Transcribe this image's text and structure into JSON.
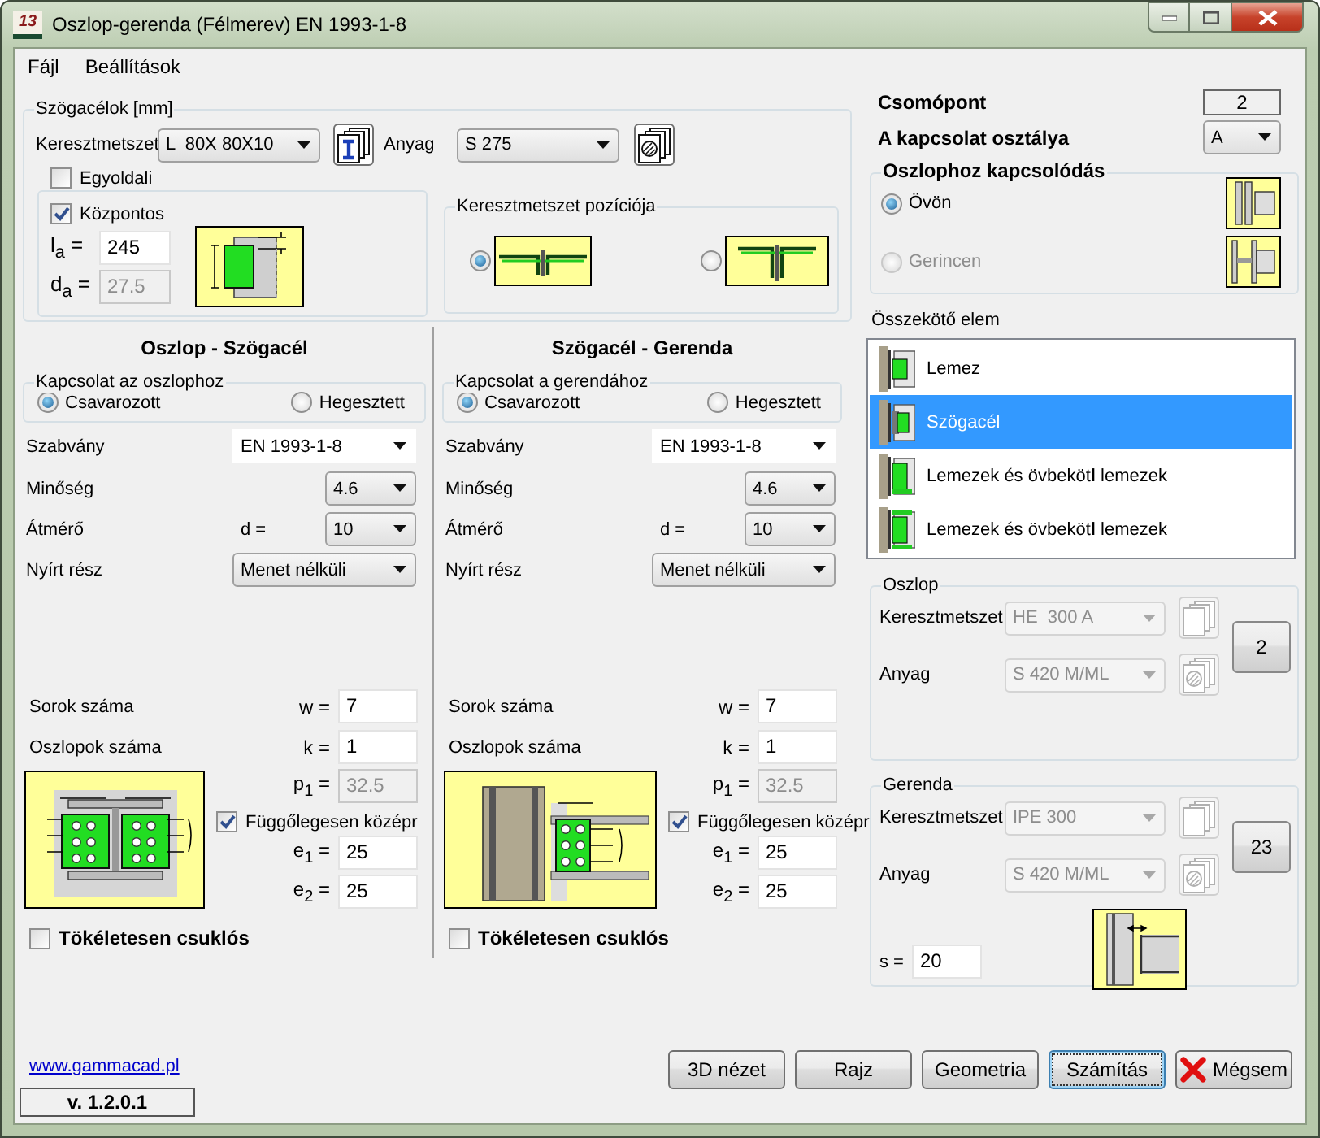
{
  "window": {
    "title": "Oszlop-gerenda (Félmerev) EN 1993-1-8",
    "app_badge": "13"
  },
  "menu": [
    "Fájl",
    "Beállítások"
  ],
  "angles": {
    "title": "Szögacélok [mm]",
    "section": {
      "label": "Keresztmetszet",
      "value": "L  80X 80X10"
    },
    "material": {
      "label": "Anyag",
      "value": "S 275"
    },
    "one_sided": {
      "label": "Egyoldali",
      "checked": false
    },
    "centric": {
      "label": "Központos",
      "checked": true
    },
    "la": {
      "label": "l$_{a}$ =",
      "value": "245",
      "disabled": false
    },
    "da": {
      "label": "d$_{a}$ =",
      "value": "27.5",
      "disabled": true
    },
    "position": {
      "title": "Keresztmetszet pozíciója",
      "options": [
        {
          "kind": "flush",
          "selected": true
        },
        {
          "kind": "raised",
          "selected": false
        }
      ]
    }
  },
  "connections": [
    {
      "kind": "column",
      "title": "Oszlop - Szögacél",
      "group": "Kapcsolat az oszlophoz",
      "options": [
        {
          "label": "Csavarozott",
          "selected": true
        },
        {
          "label": "Hegesztett",
          "selected": false
        }
      ],
      "standard": {
        "label": "Szabvány",
        "value": "EN 1993-1-8"
      },
      "grade": {
        "label": "Minőség",
        "value": "4.6"
      },
      "diameter": {
        "label": "Átmérő",
        "symbol": "d =",
        "value": "10"
      },
      "shear": {
        "label": "Nyírt rész",
        "value": "Menet nélküli"
      },
      "rows": {
        "label": "Sorok száma",
        "symbol": "w =",
        "value": "7"
      },
      "cols": {
        "label": "Oszlopok száma",
        "symbol": "k =",
        "value": "1"
      },
      "p1": {
        "symbol": "p$_{1}$ =",
        "value": "32.5",
        "disabled": true
      },
      "centered": {
        "label": "Függőlegesen középr",
        "checked": true
      },
      "e1": {
        "symbol": "e$_{1}$ =",
        "value": "25",
        "disabled": false
      },
      "e2": {
        "symbol": "e$_{2}$ =",
        "value": "25",
        "disabled": false
      },
      "pinned": {
        "label": "Tökéletesen csuklós",
        "checked": false
      }
    },
    {
      "kind": "beam",
      "title": "Szögacél - Gerenda",
      "group": "Kapcsolat a gerendához",
      "options": [
        {
          "label": "Csavarozott",
          "selected": true
        },
        {
          "label": "Hegesztett",
          "selected": false
        }
      ],
      "standard": {
        "label": "Szabvány",
        "value": "EN 1993-1-8"
      },
      "grade": {
        "label": "Minőség",
        "value": "4.6"
      },
      "diameter": {
        "label": "Átmérő",
        "symbol": "d =",
        "value": "10"
      },
      "shear": {
        "label": "Nyírt rész",
        "value": "Menet nélküli"
      },
      "rows": {
        "label": "Sorok száma",
        "symbol": "w =",
        "value": "7"
      },
      "cols": {
        "label": "Oszlopok száma",
        "symbol": "k =",
        "value": "1"
      },
      "p1": {
        "symbol": "p$_{1}$ =",
        "value": "32.5",
        "disabled": true
      },
      "centered": {
        "label": "Függőlegesen középr",
        "checked": true
      },
      "e1": {
        "symbol": "e$_{1}$ =",
        "value": "25",
        "disabled": false
      },
      "e2": {
        "symbol": "e$_{2}$ =",
        "value": "25",
        "disabled": false
      },
      "pinned": {
        "label": "Tökéletesen csuklós",
        "checked": false
      }
    }
  ],
  "joint": {
    "node": {
      "label": "Csomópont",
      "value": "2"
    },
    "class": {
      "label": "A kapcsolat osztálya",
      "value": "A"
    },
    "attach": {
      "title": "Oszlophoz kapcsolódás",
      "options": [
        {
          "kind": "flange",
          "label": "Övön",
          "selected": true,
          "disabled": false
        },
        {
          "kind": "web",
          "label": "Gerincen",
          "selected": false,
          "disabled": true
        }
      ]
    },
    "connector": {
      "title": "Összekötő elem",
      "items": [
        {
          "kind": "plate",
          "label": "Lemez",
          "selected": false
        },
        {
          "kind": "angle",
          "label": "Szögacél",
          "selected": true
        },
        {
          "kind": "end_plate",
          "label": "Lemezek és övbeköt**l** lemezek",
          "selected": false
        },
        {
          "kind": "end_plate_haunch",
          "label": "Lemezek és övbeköt**l** lemezek",
          "selected": false
        }
      ]
    },
    "members": [
      {
        "title": "Oszlop",
        "section": {
          "label": "Keresztmetszet",
          "value": "HE  300 A",
          "disabled": true
        },
        "material": {
          "label": "Anyag",
          "value": "S 420 M/ML",
          "disabled": true
        },
        "button": "2"
      },
      {
        "title": "Gerenda",
        "section": {
          "label": "Keresztmetszet",
          "value": "IPE 300",
          "disabled": true
        },
        "material": {
          "label": "Anyag",
          "value": "S 420 M/ML",
          "disabled": true
        },
        "button": "23",
        "gap": {
          "label": "s =",
          "value": "20"
        }
      }
    ]
  },
  "footer": {
    "link": "www.gammacad.pl",
    "version": "v. 1.2.0.1",
    "buttons": [
      {
        "label": "3D nézet",
        "kind": "plain"
      },
      {
        "label": "Rajz",
        "kind": "plain"
      },
      {
        "label": "Geometria",
        "kind": "plain"
      },
      {
        "label": "Számítás",
        "kind": "default"
      },
      {
        "label": "Mégsem",
        "kind": "cancel"
      }
    ]
  }
}
